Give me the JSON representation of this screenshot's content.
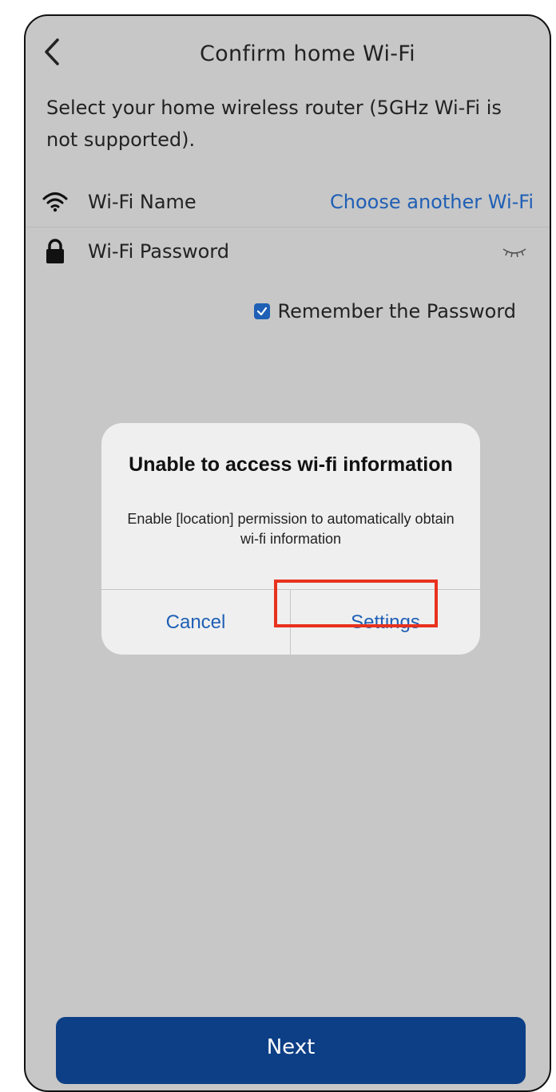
{
  "header": {
    "title": "Confirm home Wi-Fi"
  },
  "subtitle": "Select your home wireless router (5GHz Wi-Fi is not supported).",
  "wifi_name": {
    "label": "Wi-Fi Name",
    "link": "Choose another Wi-Fi"
  },
  "wifi_password": {
    "label": "Wi-Fi Password"
  },
  "remember": {
    "label": "Remember the Password",
    "checked": true
  },
  "dialog": {
    "title": "Unable to access wi-fi information",
    "message": "Enable [location] permission to automatically obtain wi-fi information",
    "cancel_label": "Cancel",
    "settings_label": "Settings"
  },
  "footer": {
    "next_label": "Next"
  },
  "colors": {
    "accent": "#1f5fb5",
    "primary_button": "#0d3f86",
    "highlight": "#e8321e",
    "background": "#c7c7c7"
  },
  "icons": {
    "back": "chevron-left-icon",
    "wifi": "wifi-icon",
    "lock": "lock-icon",
    "password_toggle": "eye-closed-icon",
    "checkbox": "checkmark-icon"
  }
}
